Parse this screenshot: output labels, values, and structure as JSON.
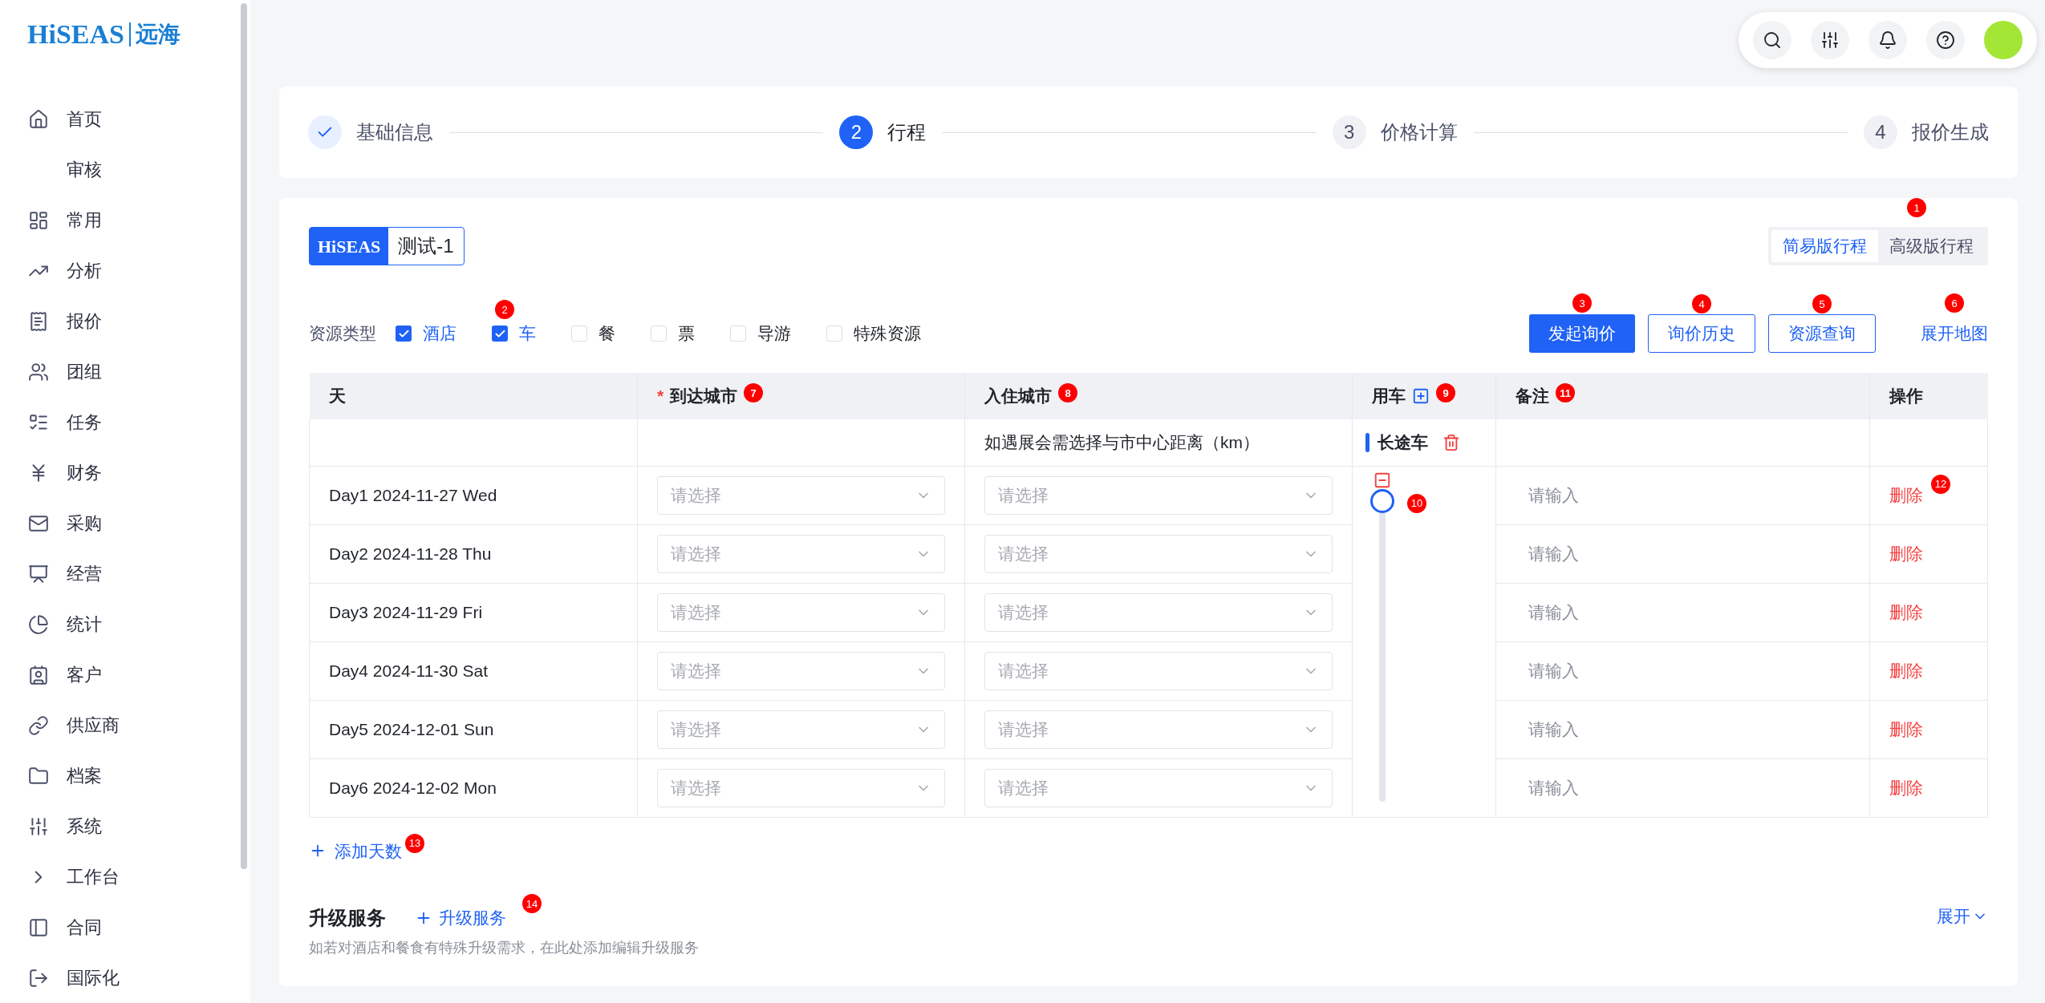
{
  "logo": {
    "brand": "HiSEAS",
    "suffix": "远海"
  },
  "sidebar": {
    "items": [
      {
        "label": "首页"
      },
      {
        "label": "审核"
      },
      {
        "label": "常用"
      },
      {
        "label": "分析"
      },
      {
        "label": "报价"
      },
      {
        "label": "团组"
      },
      {
        "label": "任务"
      },
      {
        "label": "财务"
      },
      {
        "label": "采购"
      },
      {
        "label": "经营"
      },
      {
        "label": "统计"
      },
      {
        "label": "客户"
      },
      {
        "label": "供应商"
      },
      {
        "label": "档案"
      },
      {
        "label": "系统"
      },
      {
        "label": "工作台"
      },
      {
        "label": "合同"
      },
      {
        "label": "国际化"
      }
    ]
  },
  "steps": [
    {
      "label": "基础信息",
      "completed": true,
      "selected": false
    },
    {
      "number": "2",
      "label": "行程",
      "completed": false,
      "selected": true
    },
    {
      "number": "3",
      "label": "价格计算",
      "completed": false,
      "selected": false
    },
    {
      "number": "4",
      "label": "报价生成",
      "completed": false,
      "selected": false
    }
  ],
  "project": {
    "badge": "HiSEAS",
    "name": "测试-1"
  },
  "view_tabs": [
    {
      "label": "简易版行程",
      "selected": true
    },
    {
      "label": "高级版行程",
      "selected": false,
      "marker": "1"
    }
  ],
  "resource_filter": {
    "label": "资源类型",
    "options": [
      {
        "label": "酒店",
        "checked": true
      },
      {
        "label": "车",
        "checked": true,
        "marker": "2"
      },
      {
        "label": "餐",
        "checked": false
      },
      {
        "label": "票",
        "checked": false
      },
      {
        "label": "导游",
        "checked": false
      },
      {
        "label": "特殊资源",
        "checked": false
      }
    ]
  },
  "actions": [
    {
      "label": "发起询价",
      "kind": "primary",
      "marker": "3"
    },
    {
      "label": "询价历史",
      "kind": "outline",
      "marker": "4"
    },
    {
      "label": "资源查询",
      "kind": "outline",
      "marker": "5"
    },
    {
      "label": "展开地图",
      "kind": "link",
      "marker": "6"
    }
  ],
  "table": {
    "columns": [
      {
        "label": "天"
      },
      {
        "label": "到达城市",
        "required_mark": "*",
        "marker": "7"
      },
      {
        "label": "入住城市",
        "marker": "8"
      },
      {
        "label": "用车",
        "marker": "9"
      },
      {
        "label": "备注",
        "marker": "11"
      },
      {
        "label": "操作"
      }
    ],
    "stay_hint": "如遇展会需选择与市中心距离（km）",
    "vehicle": {
      "label": "长途车",
      "level": 1,
      "marker": "10"
    },
    "rows": [
      {
        "day": "Day1 2024-11-27 Wed",
        "arrival_placeholder": "请选择",
        "stay_placeholder": "请选择",
        "note_placeholder": "请输入",
        "action": "删除",
        "marker": "12"
      },
      {
        "day": "Day2 2024-11-28 Thu",
        "arrival_placeholder": "请选择",
        "stay_placeholder": "请选择",
        "note_placeholder": "请输入",
        "action": "删除"
      },
      {
        "day": "Day3 2024-11-29 Fri",
        "arrival_placeholder": "请选择",
        "stay_placeholder": "请选择",
        "note_placeholder": "请输入",
        "action": "删除"
      },
      {
        "day": "Day4 2024-11-30 Sat",
        "arrival_placeholder": "请选择",
        "stay_placeholder": "请选择",
        "note_placeholder": "请输入",
        "action": "删除"
      },
      {
        "day": "Day5 2024-12-01 Sun",
        "arrival_placeholder": "请选择",
        "stay_placeholder": "请选择",
        "note_placeholder": "请输入",
        "action": "删除"
      },
      {
        "day": "Day6 2024-12-02 Mon",
        "arrival_placeholder": "请选择",
        "stay_placeholder": "请选择",
        "note_placeholder": "请输入",
        "action": "删除"
      }
    ]
  },
  "add_day": {
    "label": "添加天数",
    "marker": "13"
  },
  "upgrade": {
    "title": "升级服务",
    "add_label": "升级服务",
    "marker": "14",
    "description": "如若对酒店和餐食有特殊升级需求，在此处添加编辑升级服务",
    "expand": "展开"
  }
}
